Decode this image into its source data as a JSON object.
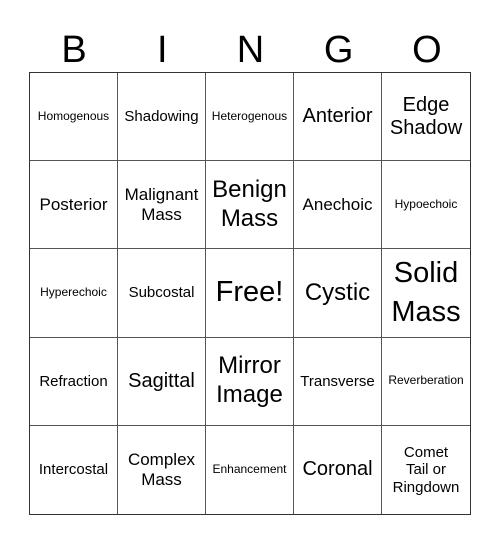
{
  "header": {
    "letters": [
      "B",
      "I",
      "N",
      "G",
      "O"
    ]
  },
  "grid": {
    "rows": [
      [
        "Homogenous",
        "Shadowing",
        "Heterogenous",
        "Anterior",
        "Edge\nShadow"
      ],
      [
        "Posterior",
        "Malignant\nMass",
        "Benign\nMass",
        "Anechoic",
        "Hypoechoic"
      ],
      [
        "Hyperechoic",
        "Subcostal",
        "Free!",
        "Cystic",
        "Solid\nMass"
      ],
      [
        "Refraction",
        "Sagittal",
        "Mirror\nImage",
        "Transverse",
        "Reverberation"
      ],
      [
        "Intercostal",
        "Complex\nMass",
        "Enhancement",
        "Coronal",
        "Comet\nTail or\nRingdown"
      ]
    ]
  }
}
